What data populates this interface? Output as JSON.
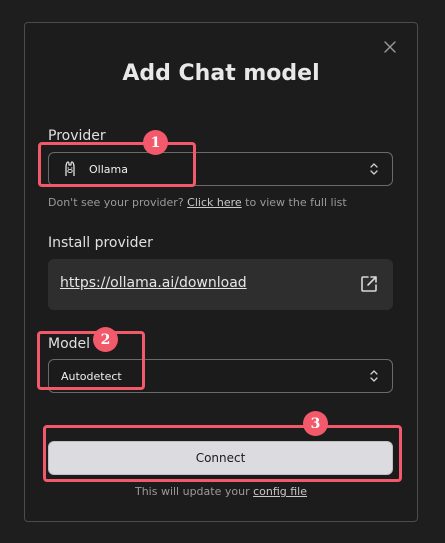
{
  "dialog": {
    "title": "Add Chat model",
    "close_icon": "close-icon"
  },
  "provider": {
    "label": "Provider",
    "selected": "Ollama",
    "icon": "ollama-llama-icon",
    "hint_prefix": "Don't see your provider?",
    "hint_link": "Click here",
    "hint_suffix": "to view the full list"
  },
  "install": {
    "label": "Install provider",
    "url": "https://ollama.ai/download",
    "icon": "external-link-icon"
  },
  "model": {
    "label": "Model",
    "selected": "Autodetect"
  },
  "connect": {
    "label": "Connect",
    "note_prefix": "This will update your",
    "note_link": "config file"
  },
  "annotations": {
    "color": "#f2596b",
    "steps": [
      "1",
      "2",
      "3"
    ]
  }
}
